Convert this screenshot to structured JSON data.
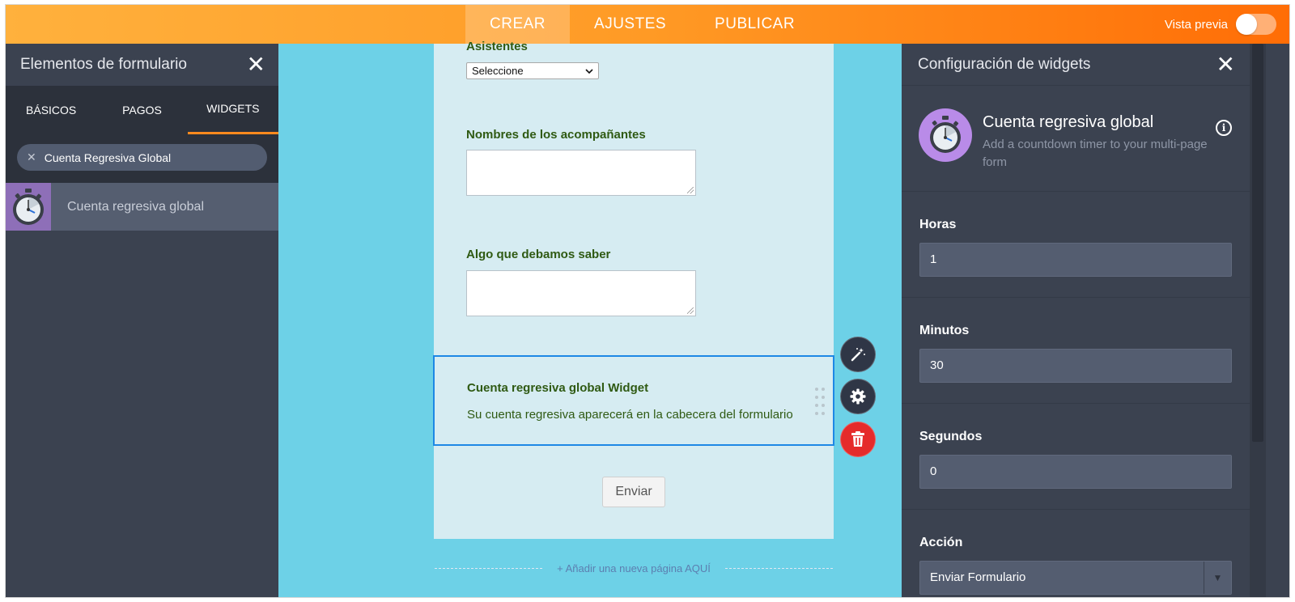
{
  "topbar": {
    "tabs": [
      "CREAR",
      "AJUSTES",
      "PUBLICAR"
    ],
    "active_tab": "CREAR",
    "preview_label": "Vista previa",
    "preview_enabled": false
  },
  "left_panel": {
    "title": "Elementos de formulario",
    "tabs": [
      "BÁSICOS",
      "PAGOS",
      "WIDGETS"
    ],
    "active_tab": "WIDGETS",
    "search_value": "Cuenta Regresiva Global",
    "results": [
      {
        "label": "Cuenta regresiva global",
        "icon": "stopwatch-icon"
      }
    ]
  },
  "form": {
    "select_question": "Asistentes",
    "select_value": "Seleccione",
    "q_companions": "Nombres de los acompañantes",
    "q_notes": "Algo que debamos saber",
    "widget_title": "Cuenta regresiva global Widget",
    "widget_desc": "Su cuenta regresiva aparecerá en la cabecera del formulario",
    "submit_label": "Enviar",
    "add_page_label": "+ Añadir una nueva página AQUÍ"
  },
  "right_panel": {
    "title": "Configuración de widgets",
    "widget_name": "Cuenta regresiva global",
    "widget_desc": "Add a countdown timer to your multi-page form",
    "fields": [
      {
        "label": "Horas",
        "value": "1"
      },
      {
        "label": "Minutos",
        "value": "30"
      },
      {
        "label": "Segundos",
        "value": "0"
      },
      {
        "label": "Acción",
        "value": "Enviar Formulario"
      }
    ]
  },
  "colors": {
    "accent_orange": "#ff8a1e",
    "selection_blue": "#1e88e5",
    "delete_red": "#e52b2b",
    "form_text_green": "#2f5a13"
  }
}
